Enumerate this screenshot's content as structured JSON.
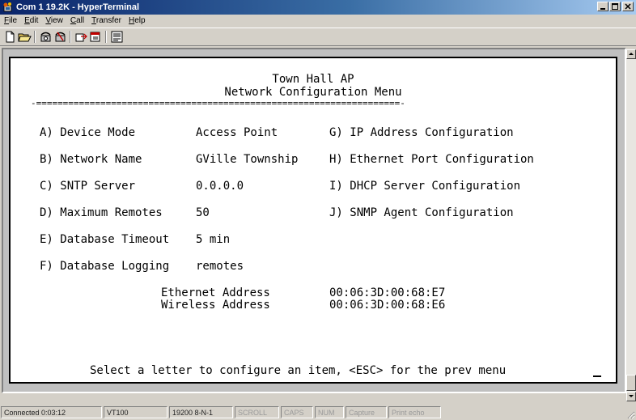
{
  "window": {
    "title": "Com 1 19.2K - HyperTerminal"
  },
  "menu": [
    {
      "key": "F",
      "rest": "ile"
    },
    {
      "key": "E",
      "rest": "dit"
    },
    {
      "key": "V",
      "rest": "iew"
    },
    {
      "key": "C",
      "rest": "all"
    },
    {
      "key": "T",
      "rest": "ransfer"
    },
    {
      "key": "H",
      "rest": "elp"
    }
  ],
  "toolbar": {
    "icons": [
      "new-icon",
      "open-icon",
      "dial-icon",
      "disconnect-icon",
      "send-icon",
      "receive-icon",
      "properties-icon"
    ]
  },
  "terminal": {
    "header_line1": "Town Hall AP",
    "header_line2": "Network Configuration Menu",
    "separator": "-====================================================================-",
    "left_options": [
      {
        "label": "A) Device Mode",
        "value": "Access Point"
      },
      {
        "label": "B) Network Name",
        "value": "GVille Township"
      },
      {
        "label": "C) SNTP Server",
        "value": "0.0.0.0"
      },
      {
        "label": "D) Maximum Remotes",
        "value": "50"
      },
      {
        "label": "E) Database Timeout",
        "value": "5 min"
      },
      {
        "label": "F) Database Logging",
        "value": "remotes"
      }
    ],
    "right_options": [
      "G) IP Address Configuration",
      "H) Ethernet Port Configuration",
      "I) DHCP Server Configuration",
      "J) SNMP Agent Configuration"
    ],
    "ethernet_label": "Ethernet Address",
    "ethernet_value": "00:06:3D:00:68:E7",
    "wireless_label": "Wireless Address",
    "wireless_value": "00:06:3D:00:68:E6",
    "prompt": "Select a letter to configure an item, <ESC> for the prev menu"
  },
  "status": {
    "connected": "Connected 0:03:12",
    "emulation": "VT100",
    "settings": "19200 8-N-1",
    "scroll": "SCROLL",
    "caps": "CAPS",
    "num": "NUM",
    "capture": "Capture",
    "print_echo": "Print echo"
  }
}
